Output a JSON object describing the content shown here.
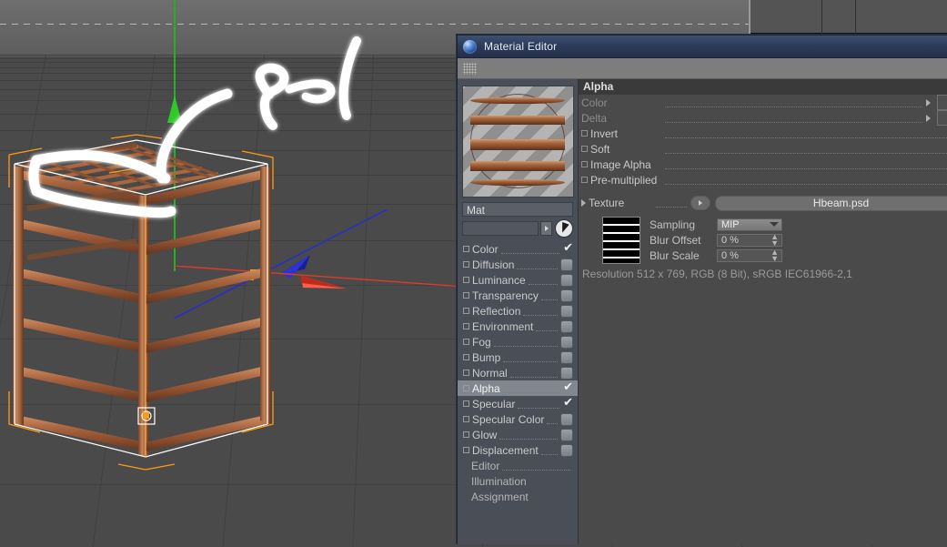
{
  "app": {
    "viewport_name": "3d-perspective-viewport"
  },
  "window": {
    "title": "Material Editor",
    "icon": "material-sphere-icon"
  },
  "material": {
    "name": "Mat",
    "preview_name": "material-preview-sphere",
    "selector_value": ""
  },
  "channels": [
    {
      "label": "Color",
      "enabled": true,
      "selected": false,
      "has_dot": true
    },
    {
      "label": "Diffusion",
      "enabled": false,
      "selected": false,
      "has_dot": true
    },
    {
      "label": "Luminance",
      "enabled": false,
      "selected": false,
      "has_dot": true
    },
    {
      "label": "Transparency",
      "enabled": false,
      "selected": false,
      "has_dot": true
    },
    {
      "label": "Reflection",
      "enabled": false,
      "selected": false,
      "has_dot": true
    },
    {
      "label": "Environment",
      "enabled": false,
      "selected": false,
      "has_dot": true
    },
    {
      "label": "Fog",
      "enabled": false,
      "selected": false,
      "has_dot": true
    },
    {
      "label": "Bump",
      "enabled": false,
      "selected": false,
      "has_dot": true
    },
    {
      "label": "Normal",
      "enabled": false,
      "selected": false,
      "has_dot": true
    },
    {
      "label": "Alpha",
      "enabled": true,
      "selected": true,
      "has_dot": true
    },
    {
      "label": "Specular",
      "enabled": true,
      "selected": false,
      "has_dot": true
    },
    {
      "label": "Specular Color",
      "enabled": false,
      "selected": false,
      "has_dot": true
    },
    {
      "label": "Glow",
      "enabled": false,
      "selected": false,
      "has_dot": true
    },
    {
      "label": "Displacement",
      "enabled": false,
      "selected": false,
      "has_dot": true
    },
    {
      "label": "Editor",
      "enabled": null,
      "selected": false,
      "has_dot": false
    },
    {
      "label": "Illumination",
      "enabled": null,
      "selected": false,
      "has_dot": false
    },
    {
      "label": "Assignment",
      "enabled": null,
      "selected": false,
      "has_dot": false
    }
  ],
  "alpha": {
    "header": "Alpha",
    "color_label": "Color",
    "delta_label": "Delta",
    "invert_label": "Invert",
    "invert_checked": false,
    "soft_label": "Soft",
    "soft_checked": true,
    "image_alpha_label": "Image Alpha",
    "image_alpha_checked": true,
    "premultiplied_label": "Pre-multiplied",
    "premultiplied_checked": false,
    "texture_label": "Texture",
    "texture_value": "Hbeam.psd",
    "sampling_label": "Sampling",
    "sampling_value": "MIP",
    "blur_offset_label": "Blur Offset",
    "blur_offset_value": "0 %",
    "blur_scale_label": "Blur Scale",
    "blur_scale_value": "0 %",
    "resolution_text": "Resolution 512 x 769, RGB (8 Bit), sRGB IEC61966-2,1"
  },
  "colors": {
    "title_bar": "#2e3c5a",
    "panel_bg": "#4a4a4a",
    "channel_pane_bg": "#4a4e56",
    "selection_highlight": "#82868e",
    "viewport_ground": "#4a4a4a",
    "beam_rust": "#a6653f",
    "axis_y_green": "#2fc92a",
    "axis_x_red": "#e03a2a",
    "axis_z_blue": "#2730c8",
    "selection_orange": "#ff9a14",
    "annotation_white": "#ffffff"
  }
}
